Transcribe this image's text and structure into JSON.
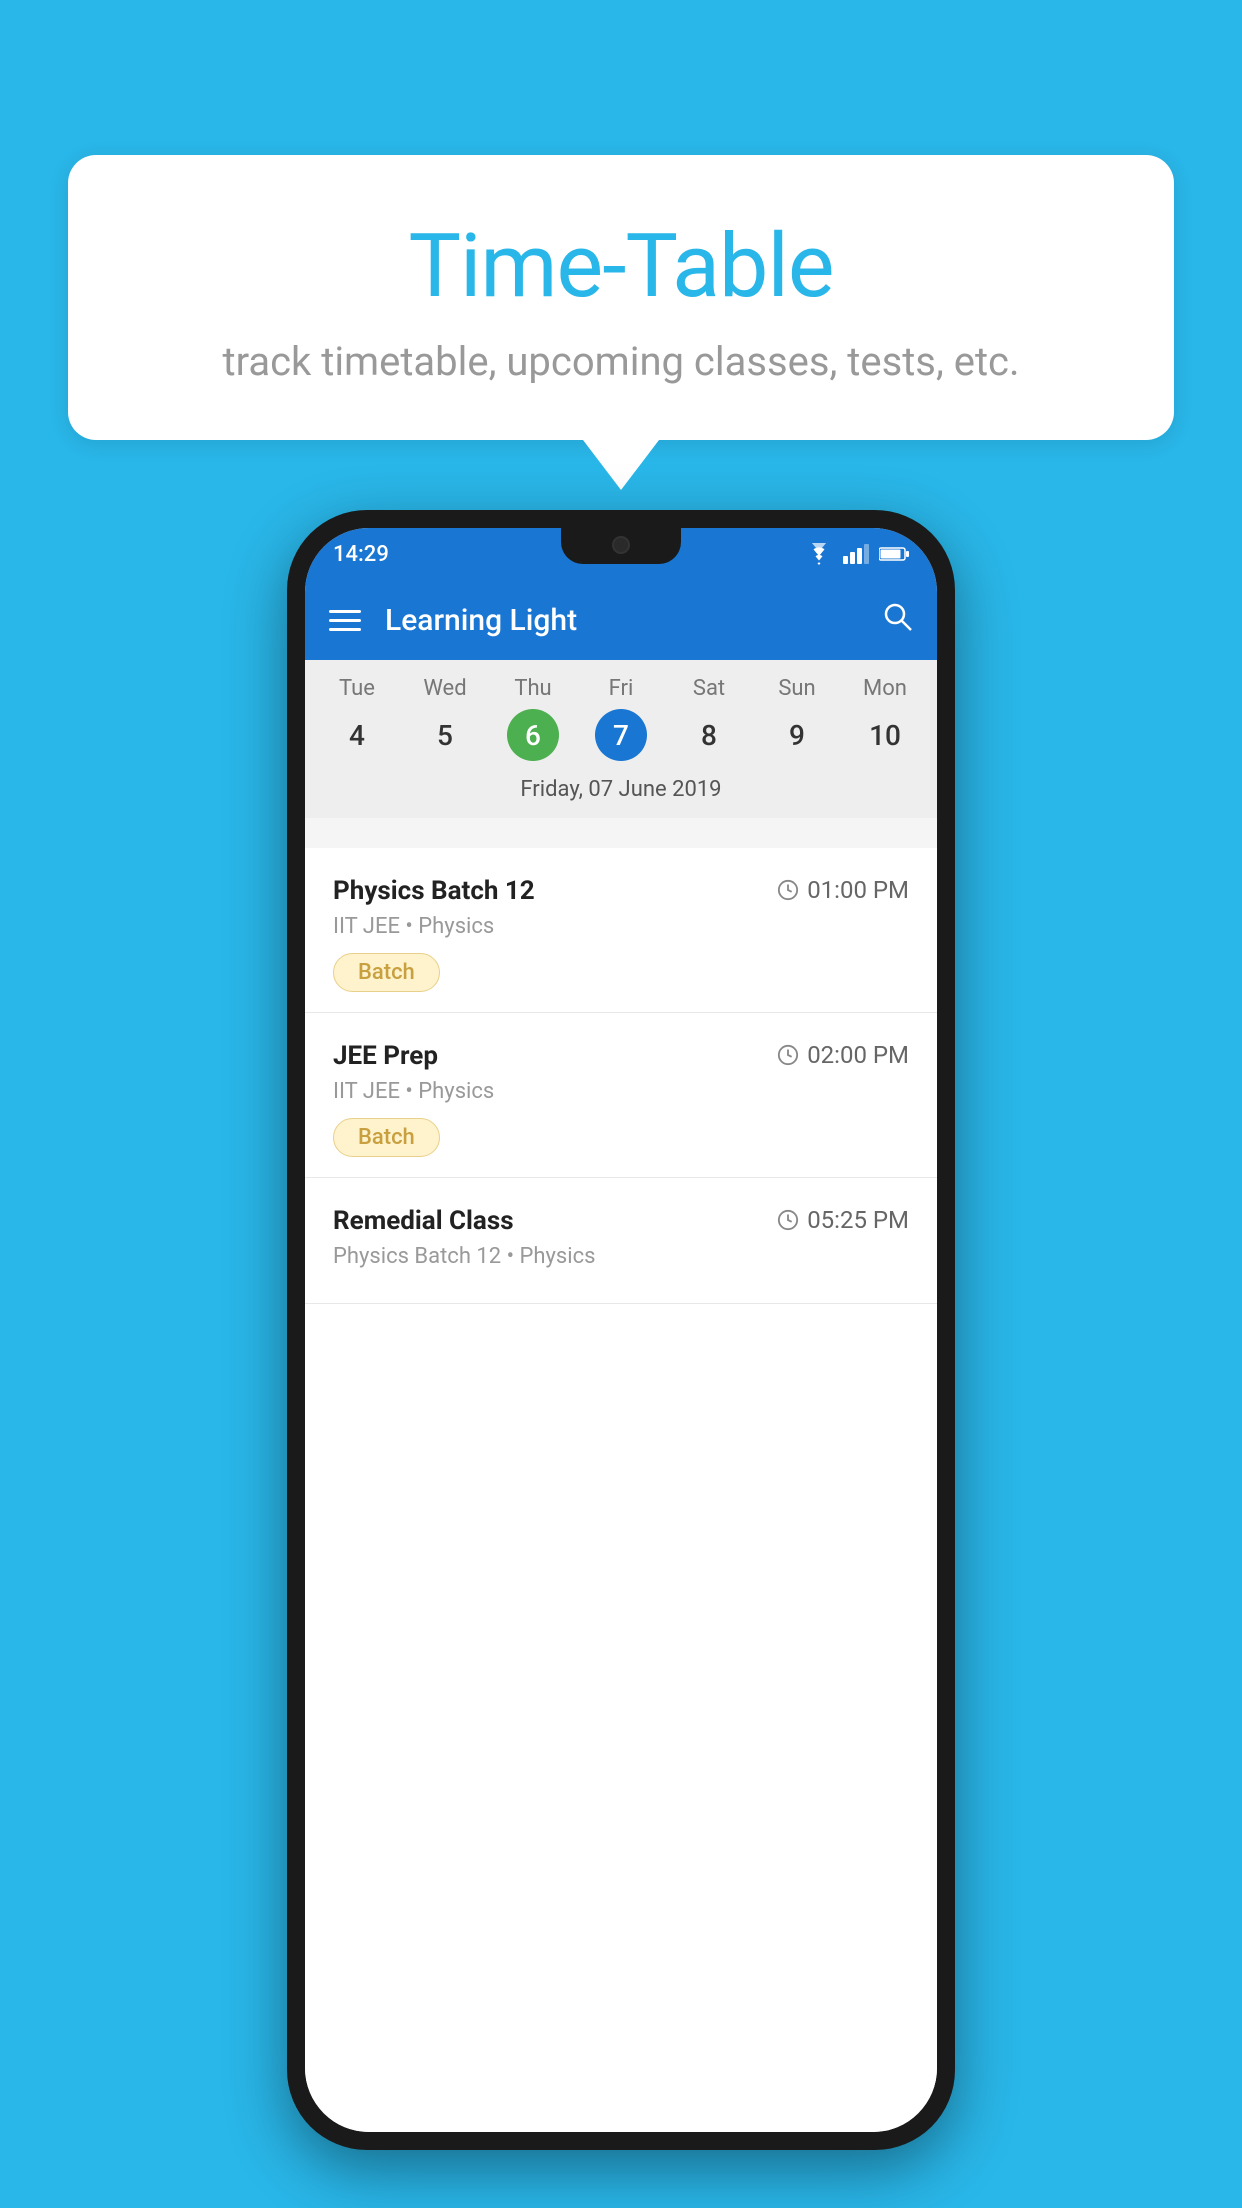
{
  "background_color": "#29b6e8",
  "speech_bubble": {
    "title": "Time-Table",
    "subtitle": "track timetable, upcoming classes, tests, etc."
  },
  "phone": {
    "status_bar": {
      "time": "14:29"
    },
    "app_bar": {
      "title": "Learning Light"
    },
    "calendar": {
      "days": [
        {
          "name": "Tue",
          "number": "4",
          "state": "normal"
        },
        {
          "name": "Wed",
          "number": "5",
          "state": "normal"
        },
        {
          "name": "Thu",
          "number": "6",
          "state": "today"
        },
        {
          "name": "Fri",
          "number": "7",
          "state": "selected"
        },
        {
          "name": "Sat",
          "number": "8",
          "state": "normal"
        },
        {
          "name": "Sun",
          "number": "9",
          "state": "normal"
        },
        {
          "name": "Mon",
          "number": "10",
          "state": "normal"
        }
      ],
      "selected_date_label": "Friday, 07 June 2019"
    },
    "schedule": [
      {
        "title": "Physics Batch 12",
        "time": "01:00 PM",
        "subtitle": "IIT JEE • Physics",
        "badge": "Batch"
      },
      {
        "title": "JEE Prep",
        "time": "02:00 PM",
        "subtitle": "IIT JEE • Physics",
        "badge": "Batch"
      },
      {
        "title": "Remedial Class",
        "time": "05:25 PM",
        "subtitle": "Physics Batch 12 • Physics",
        "badge": null
      }
    ]
  }
}
